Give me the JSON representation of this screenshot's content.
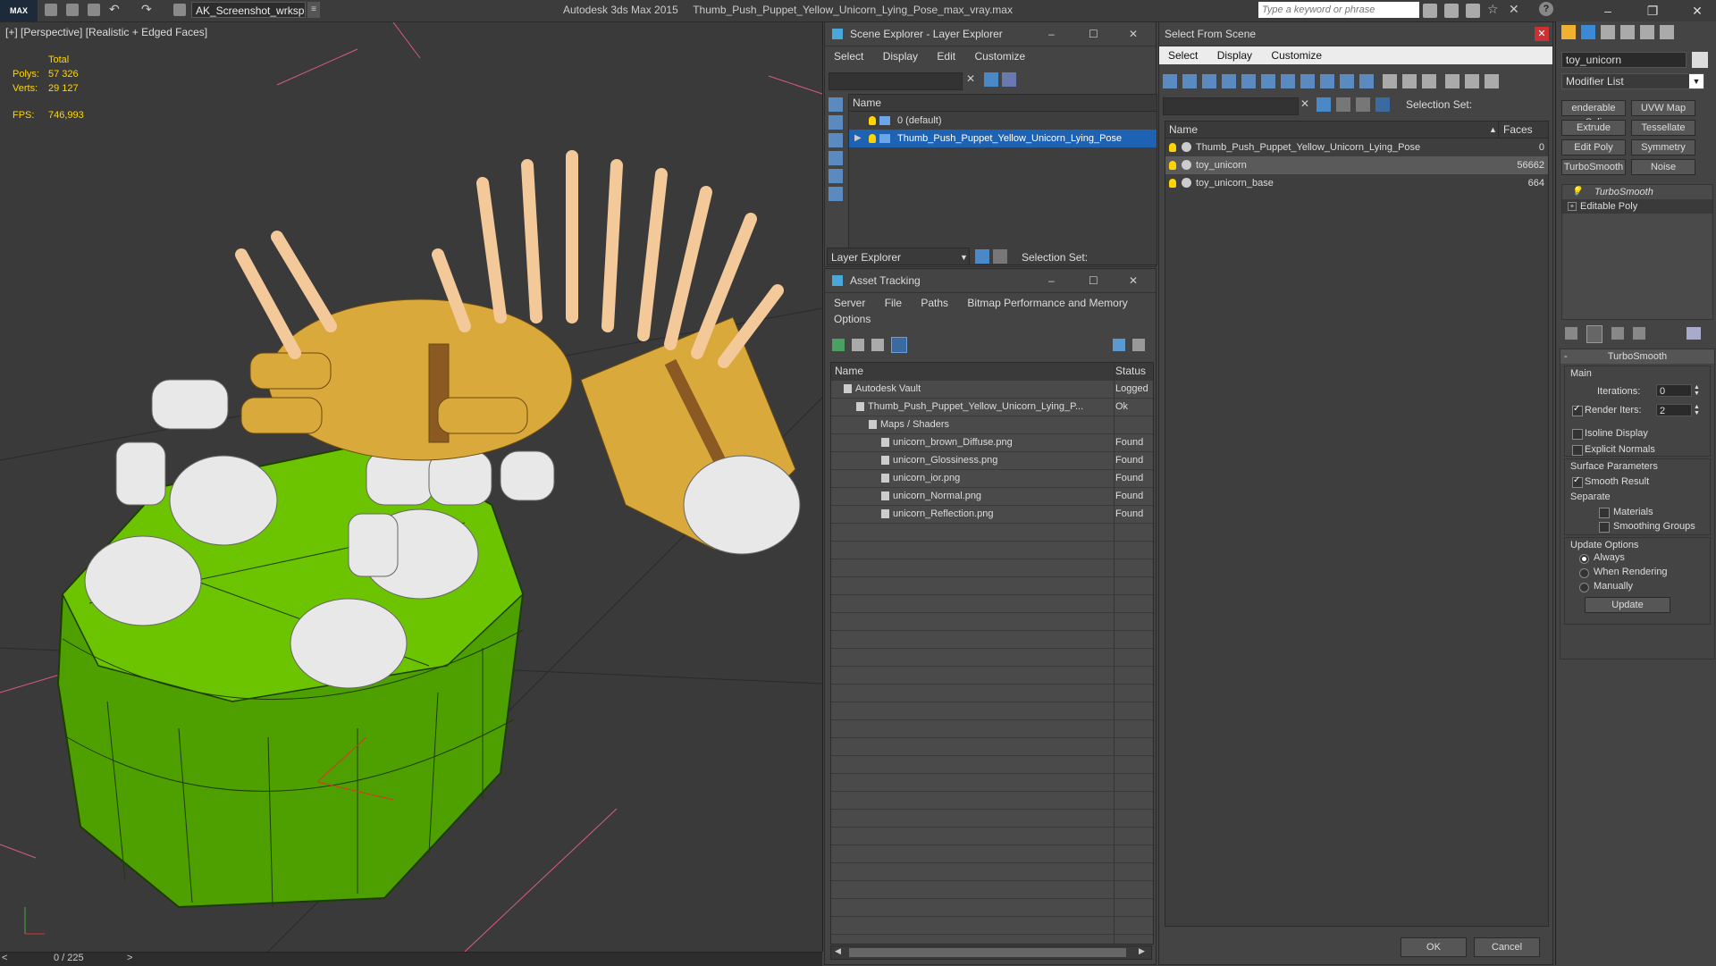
{
  "titlebar": {
    "logo": "MAX",
    "workspace": "AK_Screenshot_wrksp",
    "app_name": "Autodesk 3ds Max  2015",
    "file_name": "Thumb_Push_Puppet_Yellow_Unicorn_Lying_Pose_max_vray.max",
    "search_placeholder": "Type a keyword or phrase"
  },
  "viewport": {
    "label": "[+] [Perspective] [Realistic + Edged Faces]",
    "stats": {
      "total_label": "Total",
      "polys_label": "Polys:",
      "polys": "57 326",
      "verts_label": "Verts:",
      "verts": "29 127",
      "fps_label": "FPS:",
      "fps": "746,993"
    },
    "time": "0 / 225",
    "colors": {
      "base_green": "#5cb400",
      "body_yellow": "#d9a93c",
      "joint_white": "#e8e8e8"
    }
  },
  "scene_explorer": {
    "title": "Scene Explorer - Layer Explorer",
    "menu": [
      "Select",
      "Display",
      "Edit",
      "Customize"
    ],
    "col_name": "Name",
    "rows": [
      "0 (default)",
      "Thumb_Push_Puppet_Yellow_Unicorn_Lying_Pose"
    ],
    "footer_label": "Layer Explorer",
    "selection_set": "Selection Set:"
  },
  "asset_tracking": {
    "title": "Asset Tracking",
    "menu": [
      "Server",
      "File",
      "Paths",
      "Bitmap Performance and Memory"
    ],
    "menu2": "Options",
    "col_name": "Name",
    "col_status": "Status",
    "rows": [
      {
        "name": "Autodesk Vault",
        "status": "Logged",
        "indent": 1
      },
      {
        "name": "Thumb_Push_Puppet_Yellow_Unicorn_Lying_P...",
        "status": "Ok",
        "indent": 2
      },
      {
        "name": "Maps / Shaders",
        "status": "",
        "indent": 3
      },
      {
        "name": "unicorn_brown_Diffuse.png",
        "status": "Found",
        "indent": 4
      },
      {
        "name": "unicorn_Glossiness.png",
        "status": "Found",
        "indent": 4
      },
      {
        "name": "unicorn_ior.png",
        "status": "Found",
        "indent": 4
      },
      {
        "name": "unicorn_Normal.png",
        "status": "Found",
        "indent": 4
      },
      {
        "name": "unicorn_Reflection.png",
        "status": "Found",
        "indent": 4
      }
    ]
  },
  "select_scene": {
    "title": "Select From Scene",
    "menu": [
      "Select",
      "Display",
      "Customize"
    ],
    "selection_set": "Selection Set:",
    "col_name": "Name",
    "col_faces": "Faces",
    "rows": [
      {
        "name": "Thumb_Push_Puppet_Yellow_Unicorn_Lying_Pose",
        "faces": "0"
      },
      {
        "name": "toy_unicorn",
        "faces": "56662"
      },
      {
        "name": "toy_unicorn_base",
        "faces": "664"
      }
    ],
    "ok": "OK",
    "cancel": "Cancel"
  },
  "command_panel": {
    "object_name": "toy_unicorn",
    "modifier_list": "Modifier List",
    "buttons": [
      "enderable Spli",
      "UVW Map",
      "Extrude",
      "Tessellate",
      "Edit Poly",
      "Symmetry",
      "TurboSmooth",
      "Noise"
    ],
    "stack": [
      "TurboSmooth",
      "Editable Poly"
    ],
    "rollout_title": "TurboSmooth",
    "main": "Main",
    "iterations_label": "Iterations:",
    "iterations": "0",
    "render_iters_label": "Render Iters:",
    "render_iters": "2",
    "isoline": "Isoline Display",
    "explicit_normals": "Explicit Normals",
    "surface_params": "Surface Parameters",
    "smooth_result": "Smooth Result",
    "separate": "Separate",
    "materials": "Materials",
    "smoothing_groups": "Smoothing Groups",
    "update_options": "Update Options",
    "always": "Always",
    "when_rendering": "When Rendering",
    "manually": "Manually",
    "update": "Update"
  }
}
